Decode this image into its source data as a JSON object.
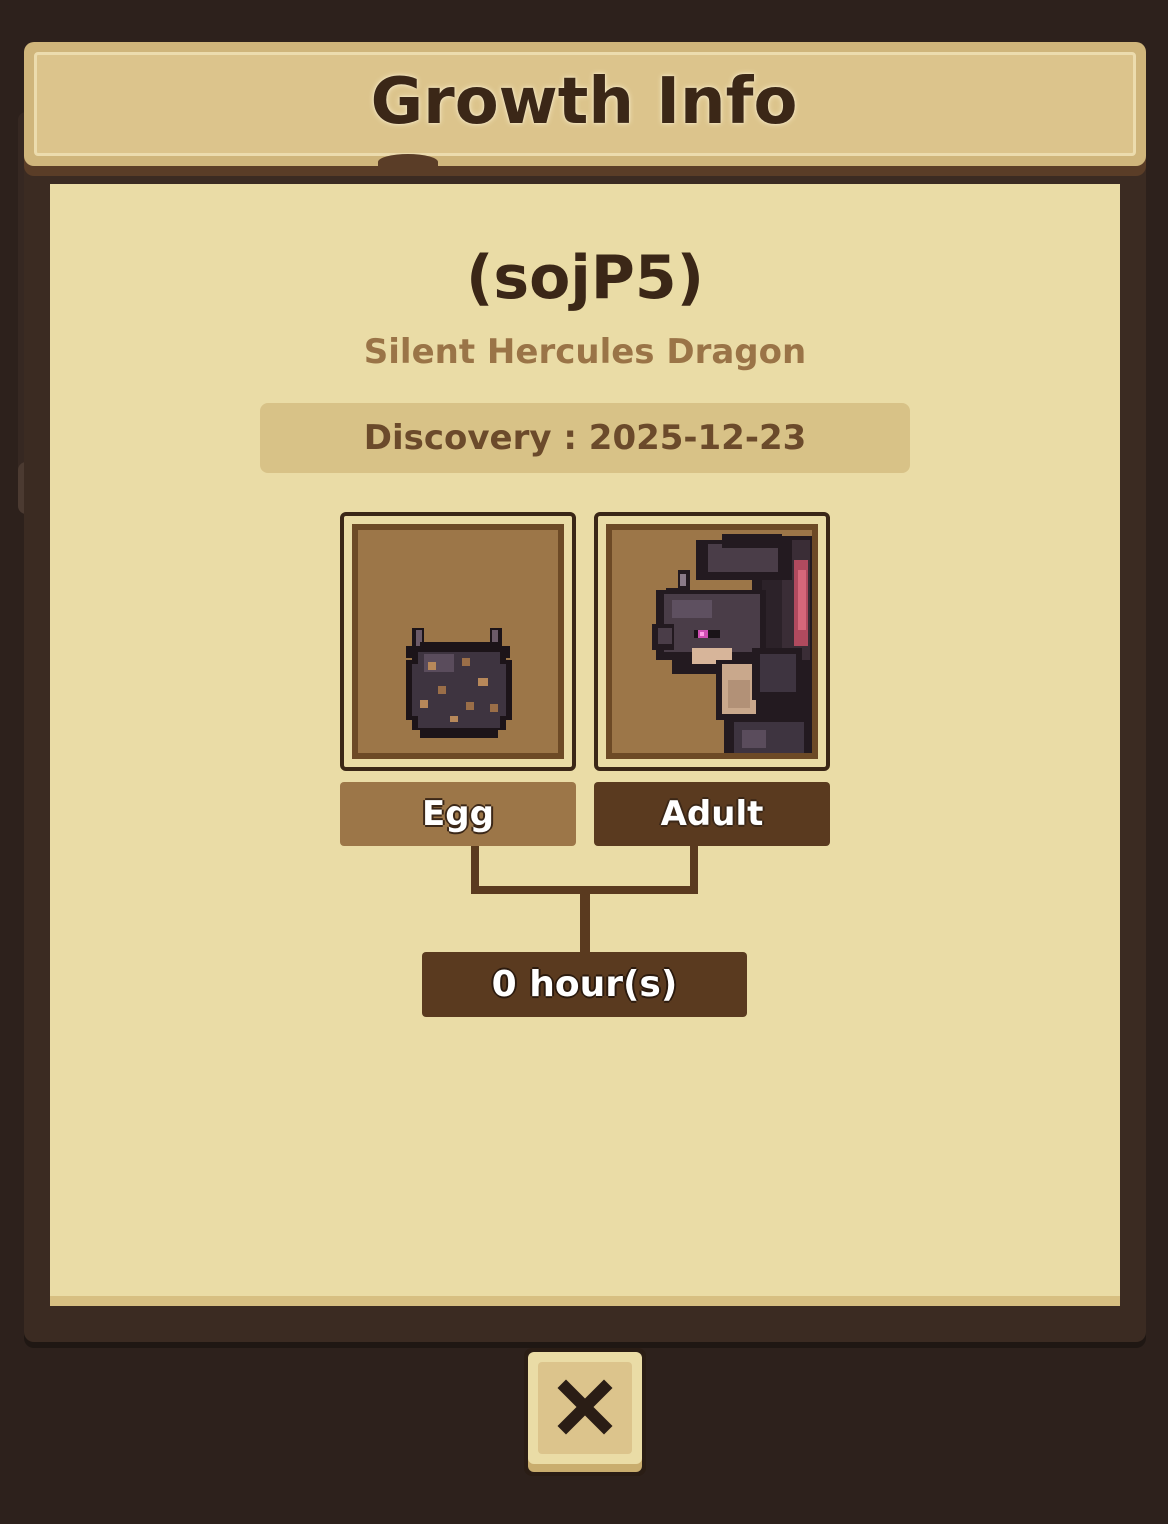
{
  "header": {
    "title": "Growth Info"
  },
  "dragon": {
    "id": "(sojP5)",
    "species": "Silent Hercules Dragon",
    "discovery_text": "Discovery : 2025-12-23"
  },
  "stages": [
    {
      "label": "Egg",
      "image": "dragon-egg-icon",
      "selected": false
    },
    {
      "label": "Adult",
      "image": "adult-dragon-portrait",
      "selected": true
    }
  ],
  "growth_time": "0 hour(s)",
  "close_button": {
    "icon": "close-x-icon"
  },
  "colors": {
    "background": "#2d211c",
    "parchment": "#eadca6",
    "header": "#dcc48c",
    "text_dark": "#3b2717",
    "text_species": "#9a7447",
    "label_dark": "#5a3a1f",
    "label_light": "#9c7648"
  }
}
